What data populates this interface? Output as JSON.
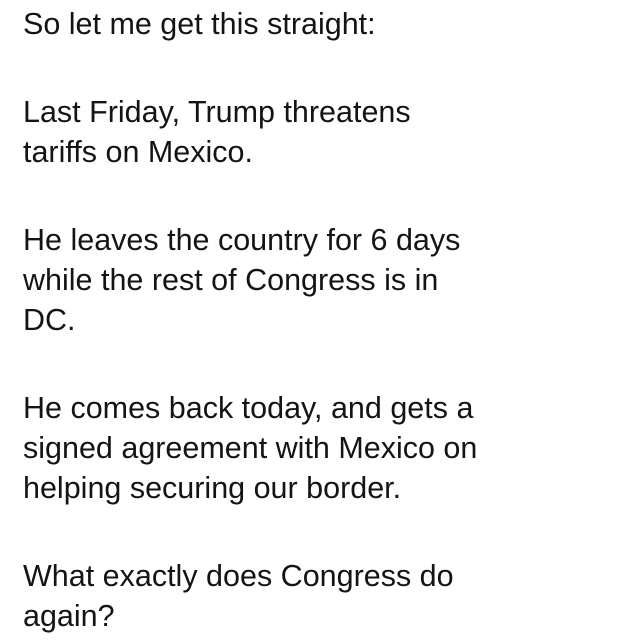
{
  "post": {
    "paragraphs": [
      {
        "lines": [
          "So let me get this straight:"
        ]
      },
      {
        "lines": [
          "Last Friday, Trump threatens",
          "tariffs on Mexico."
        ]
      },
      {
        "lines": [
          "He leaves the country for 6 days",
          "while the rest of Congress is in",
          "DC."
        ]
      },
      {
        "lines": [
          "He comes back today, and gets a",
          "signed agreement with Mexico on",
          "helping securing our border."
        ]
      },
      {
        "lines": [
          "What exactly does Congress do",
          "again?"
        ]
      }
    ]
  },
  "colors": {
    "background": "#ffffff",
    "text": "#141414"
  }
}
